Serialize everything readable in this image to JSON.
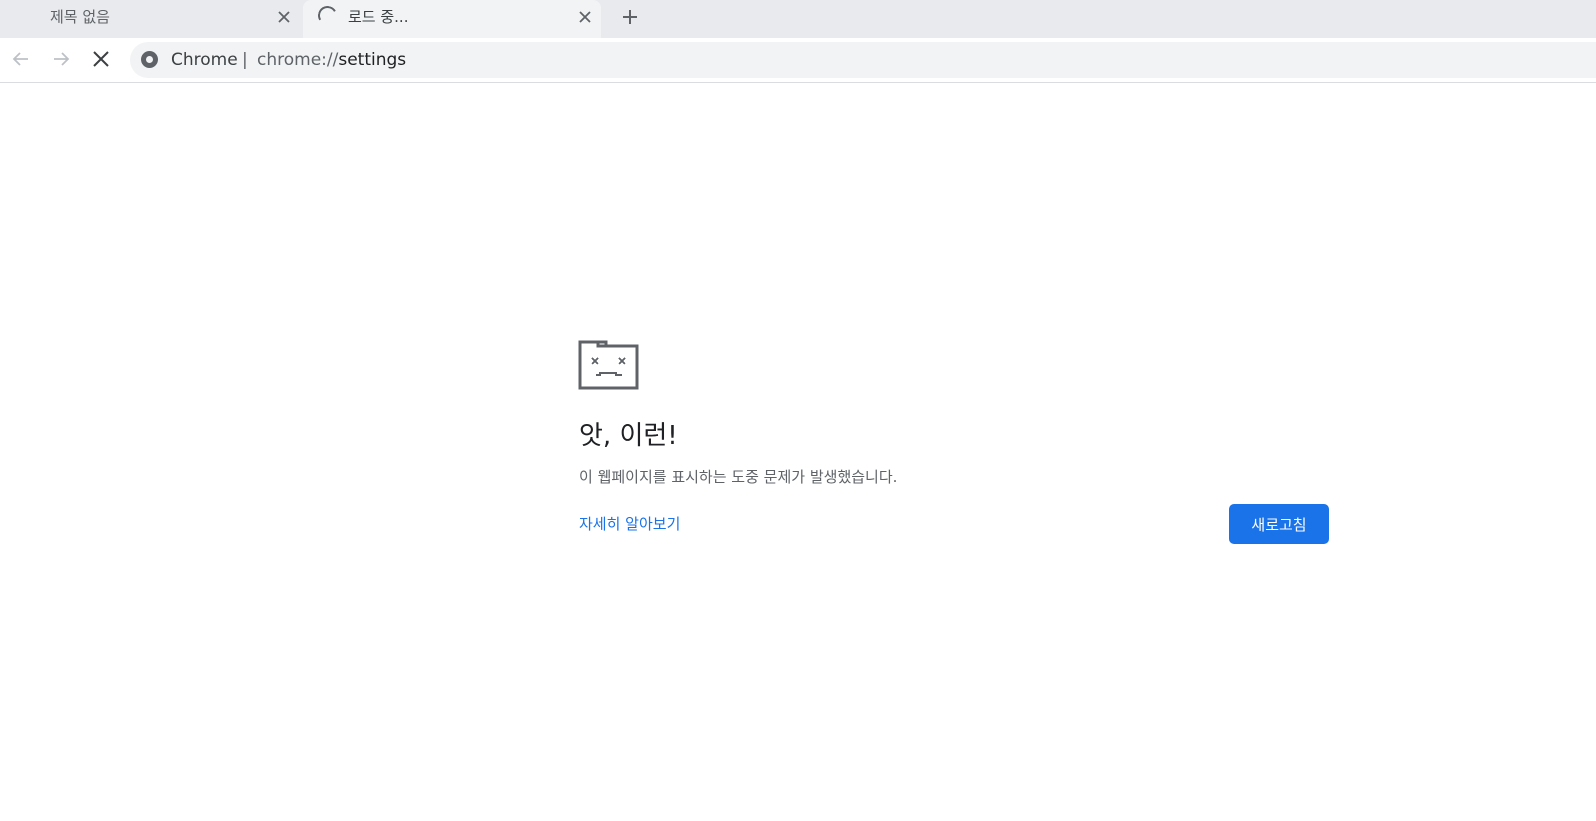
{
  "tabs": [
    {
      "title": "제목 없음",
      "state": "inactive",
      "close_icon": "close-icon"
    },
    {
      "title": "로드 중...",
      "state": "loading",
      "close_icon": "close-icon"
    }
  ],
  "new_tab_icon": "plus-icon",
  "toolbar": {
    "back_icon": "arrow-left-icon",
    "forward_icon": "arrow-right-icon",
    "stop_icon": "stop-icon"
  },
  "omnibox": {
    "site_chip_icon": "chrome-icon",
    "site_chip_label": "Chrome",
    "separator": "|",
    "url_scheme": "chrome://",
    "url_path": "settings"
  },
  "error_page": {
    "icon": "sad-folder-icon",
    "title": "앗, 이런!",
    "description": "이 웹페이지를 표시하는 도중 문제가 발생했습니다.",
    "learn_more_label": "자세히 알아보기",
    "reload_label": "새로고침"
  },
  "colors": {
    "accent": "#1a73e8",
    "tabstrip": "#e8eaed",
    "omnibox_bg": "#f1f3f4"
  }
}
